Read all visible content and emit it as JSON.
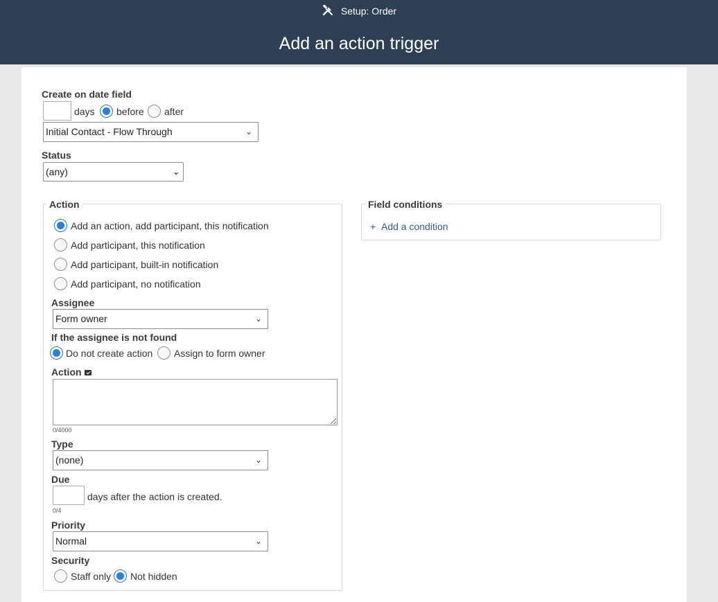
{
  "header": {
    "breadcrumb": "Setup: Order",
    "title": "Add an action trigger"
  },
  "create_on": {
    "label": "Create on date field",
    "days_value": "",
    "days_label": "days",
    "before_label": "before",
    "after_label": "after",
    "date_field_selected": "Initial Contact - Flow Through"
  },
  "status": {
    "label": "Status",
    "selected": "(any)"
  },
  "action_box": {
    "legend": "Action",
    "options": [
      "Add an action, add participant, this notification",
      "Add participant, this notification",
      "Add participant, built-in notification",
      "Add participant, no notification"
    ],
    "assignee_label": "Assignee",
    "assignee_selected": "Form owner",
    "not_found_label": "If the assignee is not found",
    "not_found_option_1": "Do not create action",
    "not_found_option_2": "Assign to form owner",
    "action_label": "Action",
    "action_value": "",
    "action_counter": "0/4000",
    "type_label": "Type",
    "type_selected": "(none)",
    "due_label": "Due",
    "due_value": "",
    "due_suffix": "days after the action is created.",
    "due_counter": "0/4",
    "priority_label": "Priority",
    "priority_selected": "Normal",
    "security_label": "Security",
    "security_option_1": "Staff only",
    "security_option_2": "Not hidden"
  },
  "field_conditions": {
    "legend": "Field conditions",
    "add_condition": "Add a condition",
    "add_glyph": "+"
  },
  "colors": {
    "header_bg": "#2e3e55",
    "accent": "#2f7fd4",
    "link": "#2f5a9a"
  },
  "icons": {
    "header": "tools-icon",
    "action_edit": "edit-icon"
  }
}
